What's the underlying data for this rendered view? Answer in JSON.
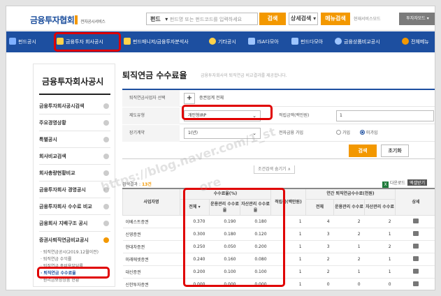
{
  "header": {
    "logo_text": "금융투자협회",
    "logo_sub": "전자공시서비스",
    "search_scope": "펀드",
    "search_placeholder": "펀드명 또는 펀드코드를 입력하세요",
    "search_button": "검색",
    "detail_search": "상세검색",
    "menu_search": "메뉴검색",
    "service_link": "현재서비스모드",
    "mode_button": "투자자모드"
  },
  "nav": {
    "items": [
      {
        "label": "펀드공시"
      },
      {
        "label": "금융투자 회사공시"
      },
      {
        "label": "펀드매니저/금융투자분석사"
      },
      {
        "label": "기타공시"
      },
      {
        "label": "ISA다모아"
      },
      {
        "label": "펀드다모아"
      },
      {
        "label": "금융상품비교공시"
      },
      {
        "label": "전체메뉴"
      }
    ]
  },
  "sidebar": {
    "title": "금융투자회사공시",
    "items": [
      {
        "label": "금융투자회사공시검색"
      },
      {
        "label": "주요경영상황"
      },
      {
        "label": "특별공시"
      },
      {
        "label": "회사비교검색"
      },
      {
        "label": "회사총량현황비교"
      },
      {
        "label": "금융투자회사 경영공시"
      },
      {
        "label": "금융투자회사 수수료 비교"
      },
      {
        "label": "금융회사 지배구조 공시"
      },
      {
        "label": "증권사퇴직연금비교공시"
      }
    ],
    "subitems": [
      {
        "label": "· 퇴직연금공시(2019.12월이전)"
      },
      {
        "label": "· 퇴직연금 수익률"
      },
      {
        "label": "· 퇴직연금 총비용부담률"
      },
      {
        "label": "· 퇴직연금 수수료율"
      },
      {
        "label": "· 원리금보장상품 현황"
      }
    ]
  },
  "main": {
    "title": "퇴직연금 수수료율",
    "description": "금융투자회사의 퇴직연금 비교결과를 제공합니다.",
    "filter": {
      "company_label": "퇴직연금사업자 선택",
      "company_add": "증권업계 전체",
      "type_label": "제도유형",
      "type_value": "개인형IRP",
      "amount_label": "적립금액(백만원)",
      "amount_value": "1",
      "term_label": "장기계약",
      "term_value": "1(년)",
      "online_label": "전자금융 가입",
      "radio_yes": "가입",
      "radio_no": "미가입",
      "search_button": "검색",
      "reset_button": "초기화",
      "collapse_button": "조건검색 숨기기 ∧"
    },
    "result": {
      "label": "검색결과 :",
      "count": "13건",
      "download": "다운로드",
      "download_small": "엑셀받기"
    },
    "table": {
      "group_fee": "수수료율(%)",
      "group_amount": "적립금(백만원)",
      "group_annual": "연간 퇴직연금수수료(천원)",
      "col_company": "사업자명",
      "col_total": "전체",
      "col_mgmt": "운용관리 수수료율",
      "col_asset": "자산관리 수수료율",
      "col_total2": "전체",
      "col_mgmt2": "운용관리 수수료",
      "col_asset2": "자산관리 수수료",
      "col_detail": "상세",
      "rows": [
        {
          "name": "이베스트증권",
          "total": "0.370",
          "mgmt": "0.190",
          "asset": "0.180",
          "amount": "1",
          "t2": "4",
          "m2": "2",
          "a2": "2"
        },
        {
          "name": "신영증권",
          "total": "0.300",
          "mgmt": "0.180",
          "asset": "0.120",
          "amount": "1",
          "t2": "3",
          "m2": "2",
          "a2": "1"
        },
        {
          "name": "현대차증권",
          "total": "0.250",
          "mgmt": "0.050",
          "asset": "0.200",
          "amount": "1",
          "t2": "3",
          "m2": "1",
          "a2": "2"
        },
        {
          "name": "미래에셋증권",
          "total": "0.240",
          "mgmt": "0.160",
          "asset": "0.080",
          "amount": "1",
          "t2": "2",
          "m2": "2",
          "a2": "1"
        },
        {
          "name": "대신증권",
          "total": "0.200",
          "mgmt": "0.100",
          "asset": "0.100",
          "amount": "1",
          "t2": "2",
          "m2": "1",
          "a2": "1"
        },
        {
          "name": "신한투자증권",
          "total": "0.000",
          "mgmt": "0.000",
          "asset": "0.000",
          "amount": "1",
          "t2": "0",
          "m2": "0",
          "a2": "0"
        }
      ]
    }
  },
  "watermark": {
    "line1": "https://blog.naver.com/1_st",
    "line2": "ore"
  },
  "colors": {
    "brand_blue": "#1d4fa0",
    "accent_orange": "#f39800",
    "highlight_red": "#e00000"
  }
}
